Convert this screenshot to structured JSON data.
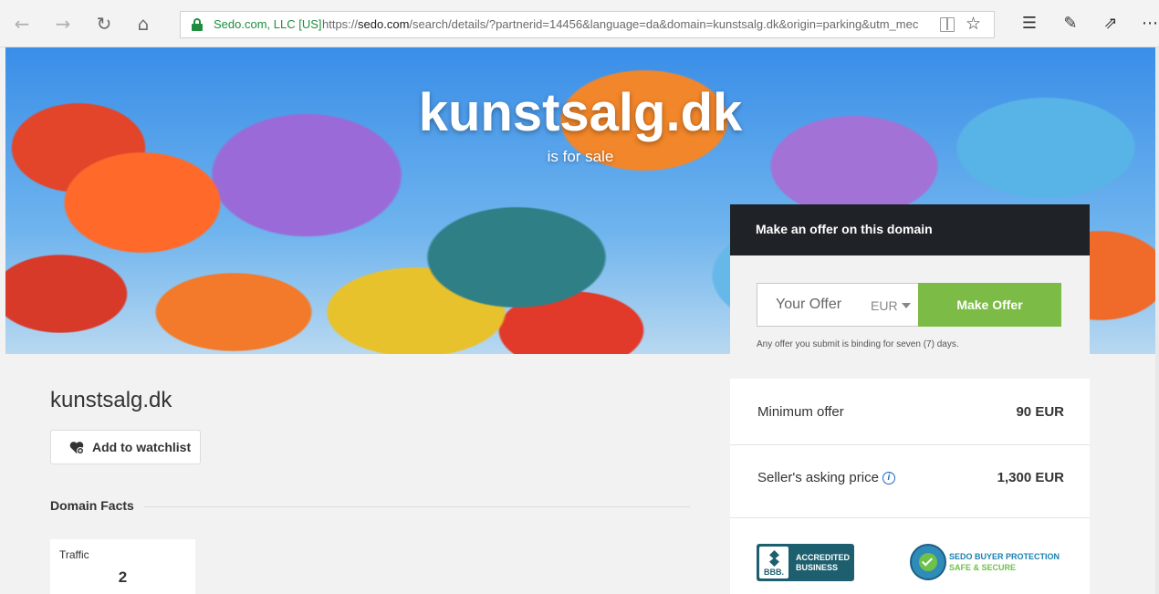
{
  "browser": {
    "cert_label": "Sedo.com, LLC [US]",
    "url_prefix": "https://",
    "url_host": "sedo.com",
    "url_rest": "/search/details/?partnerid=14456&language=da&domain=kunstsalg.dk&origin=parking&utm_mec",
    "icons": [
      "back-icon",
      "forward-icon",
      "refresh-icon",
      "home-icon",
      "lock-icon",
      "reading-view-icon",
      "favorite-star-icon",
      "favorites-hub-icon",
      "pen-icon",
      "share-icon",
      "more-icon"
    ]
  },
  "hero": {
    "title": "kunstsalg.dk",
    "subtitle": "is for sale"
  },
  "main": {
    "domain_name": "kunstsalg.dk",
    "watchlist_label": "Add to watchlist",
    "facts_title": "Domain Facts",
    "traffic_label": "Traffic",
    "traffic_value": "2"
  },
  "offer": {
    "header": "Make an offer on this domain",
    "input_placeholder": "Your Offer",
    "currency": "EUR",
    "button_label": "Make Offer",
    "note": "Any offer you submit is binding for seven (7) days.",
    "min_offer_label": "Minimum offer",
    "min_offer_value": "90 EUR",
    "asking_label": "Seller's asking price",
    "asking_value": "1,300 EUR"
  },
  "badges": {
    "bbb_mark": "BBB.",
    "bbb_line1": "ACCREDITED",
    "bbb_line2": "BUSINESS",
    "sedo_line1": "SEDO BUYER PROTECTION",
    "sedo_line2": "SAFE & SECURE"
  },
  "colors": {
    "accent_green": "#7cbc46",
    "header_dark": "#1f2327",
    "secure_green": "#1e8e3e"
  }
}
